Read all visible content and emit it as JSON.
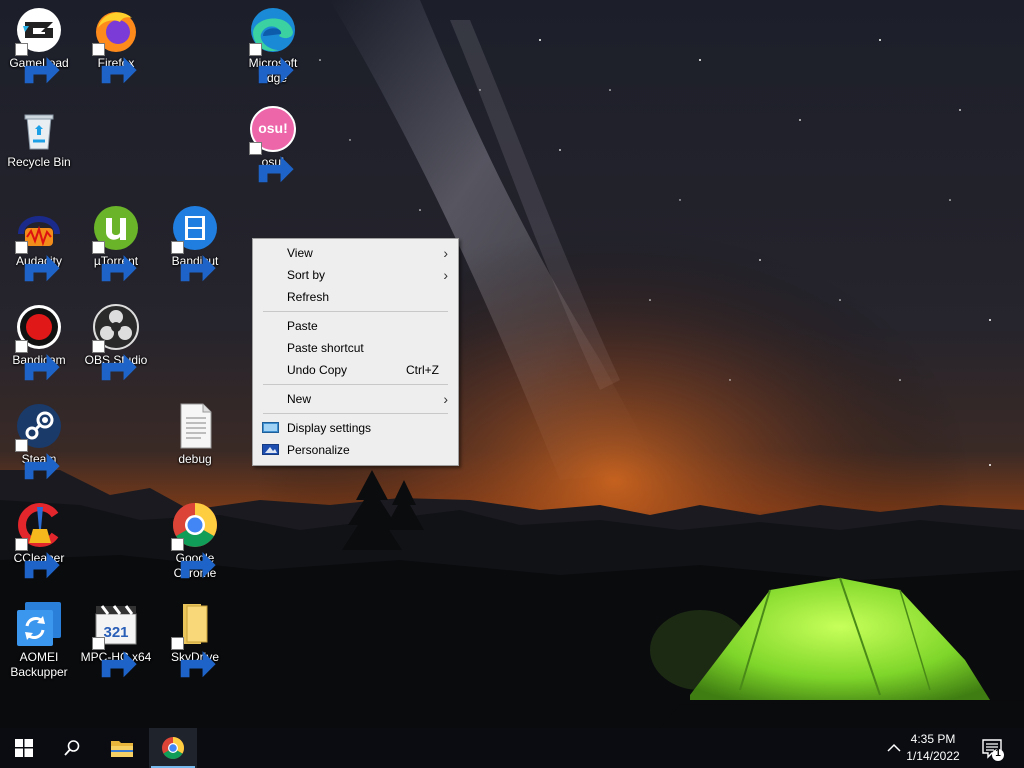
{
  "desktop_icons": [
    {
      "id": "gameload",
      "label": "GameLoad",
      "icon": "gameload-icon"
    },
    {
      "id": "firefox",
      "label": "Firefox",
      "icon": "firefox-icon"
    },
    {
      "id": "edge",
      "label": "Microsoft Edge",
      "icon": "edge-icon"
    },
    {
      "id": "recycle",
      "label": "Recycle Bin",
      "icon": "recycle-bin-icon"
    },
    {
      "id": "osu",
      "label": "osu!",
      "icon": "osu-icon",
      "icon_text": "osu!"
    },
    {
      "id": "audacity",
      "label": "Audacity",
      "icon": "audacity-icon"
    },
    {
      "id": "utorrent",
      "label": "µTorrent",
      "icon": "utorrent-icon"
    },
    {
      "id": "bandicut",
      "label": "Bandicut",
      "icon": "bandicut-icon"
    },
    {
      "id": "bandicam",
      "label": "Bandicam",
      "icon": "bandicam-icon"
    },
    {
      "id": "obs",
      "label": "OBS Studio",
      "icon": "obs-icon"
    },
    {
      "id": "steam",
      "label": "Steam",
      "icon": "steam-icon"
    },
    {
      "id": "debug",
      "label": "debug",
      "icon": "text-file-icon"
    },
    {
      "id": "ccleaner",
      "label": "CCleaner",
      "icon": "ccleaner-icon"
    },
    {
      "id": "chrome",
      "label": "Google Chrome",
      "icon": "chrome-icon"
    },
    {
      "id": "aomei",
      "label": "AOMEI Backupper",
      "icon": "aomei-icon"
    },
    {
      "id": "mpchc",
      "label": "MPC-HC x64",
      "icon": "mpc-hc-icon",
      "icon_text": "321"
    },
    {
      "id": "skydrive",
      "label": "SkyDrive",
      "icon": "folder-icon"
    }
  ],
  "context_menu": {
    "view": "View",
    "sort_by": "Sort by",
    "refresh": "Refresh",
    "paste": "Paste",
    "paste_shortcut": "Paste shortcut",
    "undo_copy": "Undo Copy",
    "undo_copy_shortcut": "Ctrl+Z",
    "new": "New",
    "display_settings": "Display settings",
    "personalize": "Personalize",
    "submenu_arrow": "›"
  },
  "taskbar": {
    "time": "4:35 PM",
    "date": "1/14/2022",
    "notification_count": "1",
    "pinned": [
      "start-icon",
      "search-icon",
      "file-explorer-icon",
      "chrome-icon"
    ],
    "accent": "#76b9ed"
  }
}
